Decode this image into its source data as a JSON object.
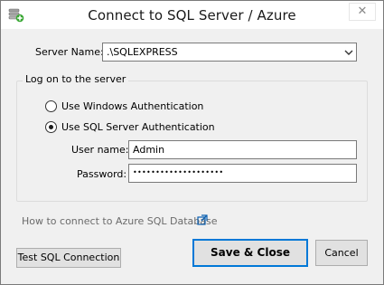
{
  "window": {
    "title": "Connect to SQL Server / Azure",
    "close_symbol": "✕"
  },
  "server": {
    "label": "Server Name:",
    "value": ".\\SQLEXPRESS"
  },
  "logon": {
    "group_title": "Log on to the server",
    "windows_auth_label": "Use Windows Authentication",
    "sql_auth_label": "Use SQL Server Authentication",
    "selected": "sql"
  },
  "credentials": {
    "username_label": "User name:",
    "username_value": "Admin",
    "password_label": "Password:",
    "password_mask": "••••••••••••••••••••"
  },
  "links": {
    "azure_help": "How to connect to Azure SQL Database"
  },
  "buttons": {
    "test": "Test SQL Connection",
    "save": "Save & Close",
    "cancel": "Cancel"
  },
  "colors": {
    "accent": "#0078d7",
    "icon_green": "#3aa835"
  },
  "icons": {
    "app": "database-add-icon",
    "combo_arrow": "chevron-down-icon",
    "external_link": "external-link-icon",
    "close": "close-icon"
  }
}
